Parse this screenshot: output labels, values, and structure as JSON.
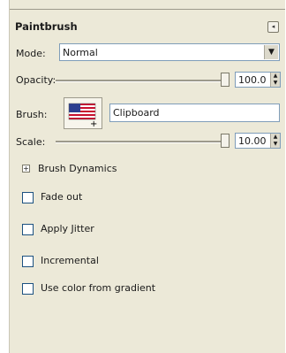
{
  "panel": {
    "title": "Paintbrush",
    "mode": {
      "label": "Mode:",
      "value": "Normal"
    },
    "opacity": {
      "label": "Opacity:",
      "value": "100.0"
    },
    "brush": {
      "label": "Brush:",
      "name": "Clipboard"
    },
    "scale": {
      "label": "Scale:",
      "value": "10.00"
    },
    "brush_dynamics": {
      "label": "Brush Dynamics",
      "expander": "+"
    },
    "options": [
      {
        "label": "Fade out",
        "checked": false
      },
      {
        "label": "Apply Jitter",
        "checked": false
      },
      {
        "label": "Incremental",
        "checked": false
      },
      {
        "label": "Use color from gradient",
        "checked": false
      }
    ]
  },
  "icons": {
    "dock": "tab-menu-icon",
    "combo_arrow": "chevron-down-icon",
    "spin": "spin-arrows-icon",
    "brush_preview": "us-flag-brush-icon"
  },
  "colors": {
    "panel_bg": "#ece9d8",
    "field_border": "#7f9db9"
  }
}
